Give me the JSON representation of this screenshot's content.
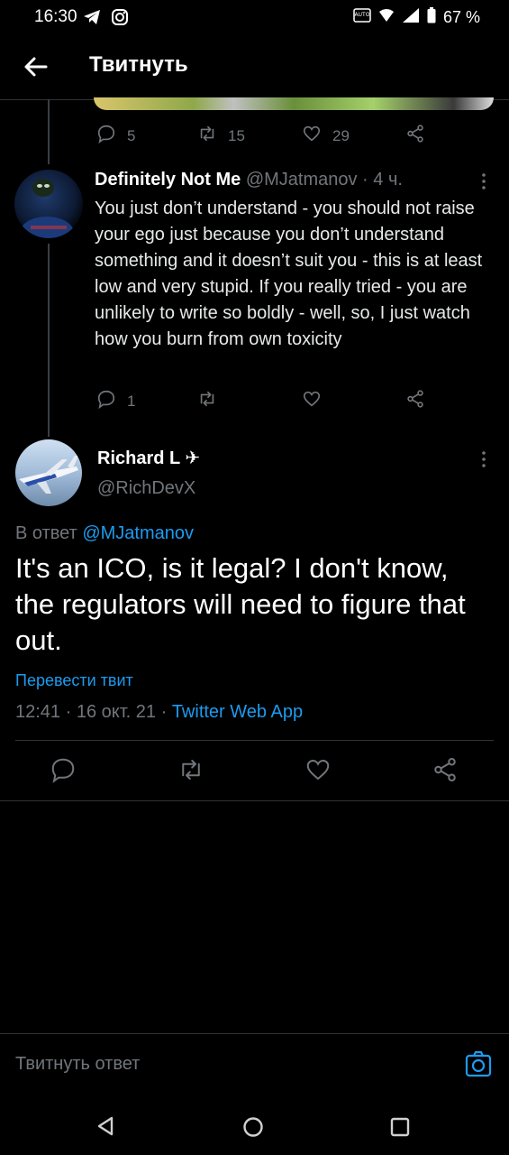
{
  "status_bar": {
    "time": "16:30",
    "battery": "67 %",
    "icons": [
      "telegram-icon",
      "instagram-icon",
      "auto-hd-icon",
      "wifi-icon",
      "signal-icon",
      "battery-icon"
    ]
  },
  "header": {
    "title": "Твитнуть"
  },
  "prev_tweet_actions": {
    "replies": "5",
    "retweets": "15",
    "likes": "29"
  },
  "reply_tweet": {
    "name": "Definitely Not Me",
    "handle_time": "@MJatmanov · 4 ч.",
    "text": "You just don’t understand - you should not raise your ego just because you don’t understand something and it doesn’t suit you - this is at least low and very stupid. If you really tried  - you are unlikely to write so boldly - well, so, I just watch how you burn from own toxicity",
    "replies": "1"
  },
  "main_tweet": {
    "name": "Richard L ✈",
    "handle": "@RichDevX",
    "reply_prefix": "В ответ ",
    "reply_handle": "@MJatmanov",
    "text": "It's an ICO, is it legal? I don't know, the regulators will need to figure that out.",
    "translate": "Перевести твит",
    "meta_date": "12:41 · 16 окт. 21 · ",
    "meta_source": "Twitter Web App"
  },
  "composer": {
    "placeholder": "Твитнуть ответ"
  },
  "colors": {
    "background": "#000000",
    "accent": "#1d9bf0",
    "muted": "#71767b",
    "divider": "#2f3336"
  }
}
